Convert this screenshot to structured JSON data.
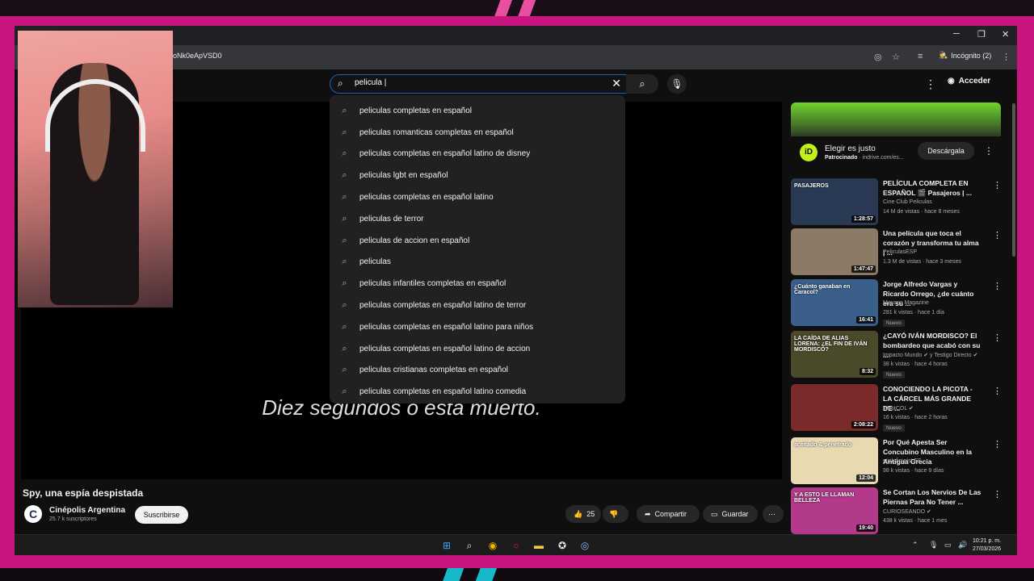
{
  "browser": {
    "url": "oNk0eApVSD0",
    "incognito_label": "Incógnito (2)"
  },
  "header": {
    "search_value": "pelicula |",
    "signin_label": "Acceder"
  },
  "suggestions": [
    "peliculas completas en español",
    "peliculas romanticas completas en español",
    "peliculas completas en español latino de disney",
    "peliculas lgbt en español",
    "peliculas completas en español latino",
    "peliculas de terror",
    "peliculas de accion en español",
    "peliculas",
    "peliculas infantiles completas en español",
    "peliculas completas en español latino de terror",
    "peliculas completas en español latino para niños",
    "peliculas completas en español latino de accion",
    "peliculas cristianas completas en español",
    "peliculas completas en español latino comedia"
  ],
  "player": {
    "subtitle": "Diez segundos o está muerto."
  },
  "video": {
    "title": "Spy, una espía despistada",
    "channel": "Cinépolis Argentina",
    "subscribers": "25.7 k suscriptores",
    "subscribe_label": "Suscribirse",
    "likes": "25",
    "share_label": "Compartir",
    "save_label": "Guardar"
  },
  "ad": {
    "title": "Elegir es justo",
    "sponsored": "Patrocinado",
    "domain": "· indrive.com/es...",
    "button": "Descárgala",
    "logo": "iD"
  },
  "recommendations": [
    {
      "title": "PELÍCULA COMPLETA EN ESPAÑOL 🎬 Pasajeros | ...",
      "channel": "Cine Club Peliculas",
      "meta": "14 M de vistas · hace 8 meses",
      "duration": "1:28:57",
      "badge": "",
      "thumb_label": "PASAJEROS",
      "thumb_color": "#2a3a55"
    },
    {
      "title": "Una película que toca el corazón y transforma tu alma | ...",
      "channel": "PeliculasESP",
      "meta": "1.3 M de vistas · hace 3 meses",
      "duration": "1:47:47",
      "badge": "",
      "thumb_label": "",
      "thumb_color": "#8a7a66"
    },
    {
      "title": "Jorge Alfredo Vargas y Ricardo Orrego, ¿de cuánto era su ...",
      "channel": "Mayans Magazine",
      "meta": "281 k vistas · hace 1 día",
      "duration": "16:41",
      "badge": "Nuevo",
      "thumb_label": "¿Cuánto ganaban en Caracol?",
      "thumb_color": "#3a5f8a"
    },
    {
      "title": "¿CAYÓ IVÁN MORDISCO? El bombardeo que acabó con su ...",
      "channel": "Impacto Mundo ✔ y Testigo Directo ✔",
      "meta": "38 k vistas · hace 4 horas",
      "duration": "8:32",
      "badge": "Nuevo",
      "thumb_label": "LA CAÍDA DE ALIAS LORENA: ¿EL FIN DE IVÁN MORDISCO?",
      "thumb_color": "#4a4a2a"
    },
    {
      "title": "CONOCIENDO LA PICOTA - LA CÁRCEL MÁS GRANDE DE ...",
      "channel": "WestCOL ✔",
      "meta": "16 k vistas · hace 2 horas",
      "duration": "2:08:22",
      "badge": "Nuevo",
      "thumb_label": "",
      "thumb_color": "#7a2a2a"
    },
    {
      "title": "Por Qué Apesta Ser Concubino Masculino en la Antigua Grecia",
      "channel": "stick figurist ES",
      "meta": "98 k vistas · hace 9 días",
      "duration": "12:04",
      "badge": "",
      "thumb_label": "aceitado & penetrado",
      "thumb_color": "#e8d9b0"
    },
    {
      "title": "Se Cortan Los Nervios De Las Piernas Para No Tener ...",
      "channel": "CURIOSEANDO ✔",
      "meta": "438 k vistas · hace 1 mes",
      "duration": "19:40",
      "badge": "",
      "thumb_label": "Y A ESTO LE LLAMAN BELLEZA",
      "thumb_color": "#b33a8a"
    }
  ],
  "taskbar": {
    "time": "10:21 p. m.",
    "date": "27/03/2026"
  },
  "colors": {
    "border_magenta": "#c8157f",
    "youtube_bg": "#0f0f0f",
    "search_focus": "#1c62b9",
    "ad_green": "#6fd42c"
  }
}
